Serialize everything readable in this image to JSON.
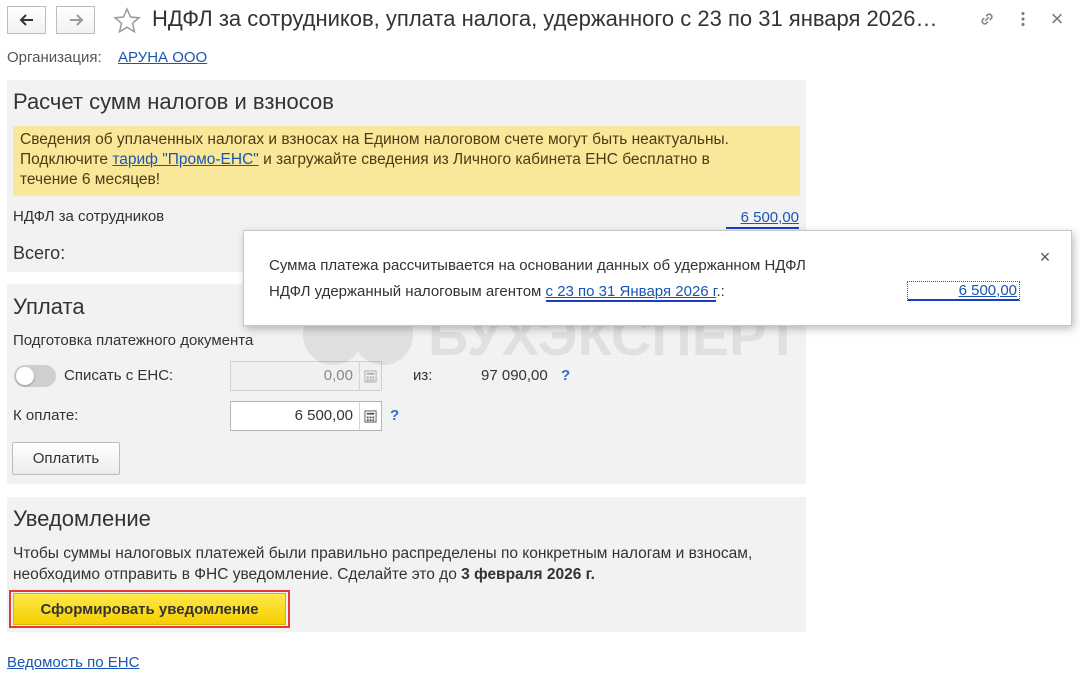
{
  "header": {
    "title": "НДФЛ за сотрудников, уплата налога, удержанного с 23 по 31 января 2026…"
  },
  "organization": {
    "label": "Организация:",
    "value": "АРУНА ООО"
  },
  "calc_section": {
    "title": "Расчет сумм налогов и взносов",
    "notice_line1": "Сведения об уплаченных налогах и взносах на Едином налоговом счете могут быть неактуальны.",
    "notice_line2_before": "Подключите ",
    "notice_link": "тариф \"Промо-ЕНС\"",
    "notice_line2_after": " и загружайте сведения из Личного кабинета ЕНС бесплатно в",
    "notice_line3": "течение 6 месяцев!",
    "ndfl_label": "НДФЛ за сотрудников",
    "ndfl_amount": "6 500,00",
    "total_label": "Всего:"
  },
  "payment_section": {
    "title": "Уплата",
    "subtitle": "Подготовка платежного документа",
    "writeoff_label": "Списать с ЕНС:",
    "writeoff_value": "0,00",
    "writeoff_enabled": false,
    "from_label": "из:",
    "from_value": "97 090,00",
    "help": "?",
    "to_pay_label": "К оплате:",
    "to_pay_value": "6 500,00",
    "pay_button": "Оплатить"
  },
  "notice_section": {
    "title": "Уведомление",
    "text_before": "Чтобы суммы налоговых платежей были правильно распределены по конкретным налогам и взносам, необходимо отправить в ФНС уведомление. Сделайте это до ",
    "deadline": "3 февраля 2026 г.",
    "button": "Сформировать уведомление"
  },
  "bottom_link": "Ведомость по ЕНС",
  "popup": {
    "line1": "Сумма платежа рассчитывается на основании данных об удержанном НДФЛ",
    "line2_prefix": "НДФЛ удержанный налоговым агентом ",
    "period": "с 23 по 31 Января 2026 г",
    "line2_suffix": ".:",
    "amount": "6 500,00",
    "close": "×"
  },
  "colors": {
    "accent_link": "#1a56b3",
    "notice_bg": "#f9e79a",
    "primary_button": "#f5cf00",
    "highlight_outline": "#e53935"
  }
}
